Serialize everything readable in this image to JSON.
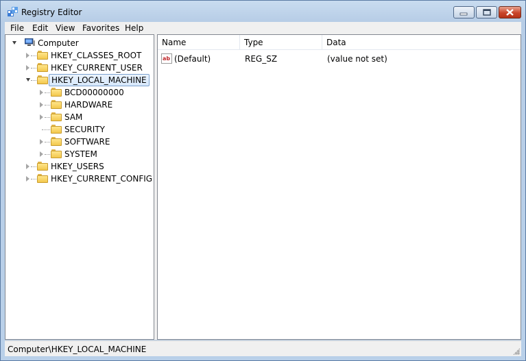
{
  "window": {
    "title": "Registry Editor",
    "app_icon": "registry-editor-icon"
  },
  "caption_buttons": {
    "minimize": "minimize-icon",
    "maximize": "maximize-icon",
    "close": "close-icon"
  },
  "menu": {
    "items": [
      "File",
      "Edit",
      "View",
      "Favorites",
      "Help"
    ]
  },
  "tree": {
    "root": "Computer",
    "hives": [
      {
        "label": "HKEY_CLASSES_ROOT",
        "expanded": false
      },
      {
        "label": "HKEY_CURRENT_USER",
        "expanded": false
      },
      {
        "label": "HKEY_LOCAL_MACHINE",
        "expanded": true,
        "selected": true,
        "children": [
          {
            "label": "BCD00000000",
            "has_children": true
          },
          {
            "label": "HARDWARE",
            "has_children": true
          },
          {
            "label": "SAM",
            "has_children": true
          },
          {
            "label": "SECURITY",
            "has_children": false
          },
          {
            "label": "SOFTWARE",
            "has_children": true
          },
          {
            "label": "SYSTEM",
            "has_children": true
          }
        ]
      },
      {
        "label": "HKEY_USERS",
        "expanded": false
      },
      {
        "label": "HKEY_CURRENT_CONFIG",
        "expanded": false
      }
    ]
  },
  "values_list": {
    "columns": [
      "Name",
      "Type",
      "Data"
    ],
    "rows": [
      {
        "name": "(Default)",
        "type": "REG_SZ",
        "data": "(value not set)",
        "icon": "string-value-icon"
      }
    ]
  },
  "status": {
    "path": "Computer\\HKEY_LOCAL_MACHINE"
  },
  "colors": {
    "title_bar": "#b9d0e9",
    "close_button": "#c9452b",
    "selection_border": "#7da2ce",
    "folder": "#f3c84d"
  }
}
